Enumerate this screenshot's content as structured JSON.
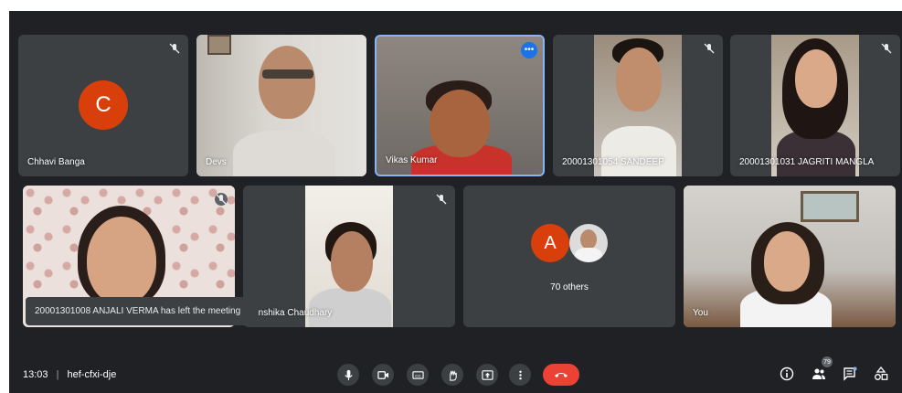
{
  "participants": [
    {
      "name": "Chhavi Banga",
      "avatar_letter": "C"
    },
    {
      "name": "Devs"
    },
    {
      "name": "Vikas Kumar"
    },
    {
      "name": "20001301054 SANDEEP"
    },
    {
      "name": "20001301031 JAGRITI MANGLA"
    },
    {
      "name": ""
    },
    {
      "name": "Anshika Chaudhary"
    },
    {
      "name": "70 others",
      "avatar_letter": "A"
    },
    {
      "name": "You"
    }
  ],
  "toast": "20001301008 ANJALI VERMA has left the meeting",
  "meeting": {
    "time": "13:03",
    "code": "hef-cfxi-dje"
  },
  "participant_count": "79",
  "colors": {
    "background": "#202124",
    "tile": "#3c4043",
    "end_call": "#ea4335",
    "avatar_orange": "#d93f0b",
    "active_border": "#8ab4f8"
  },
  "icons": {
    "toolbar": [
      "mic-icon",
      "camera-icon",
      "captions-icon",
      "raise-hand-icon",
      "present-icon",
      "more-options-icon",
      "end-call-icon"
    ],
    "right": [
      "info-icon",
      "people-icon",
      "chat-icon",
      "activities-icon"
    ]
  }
}
